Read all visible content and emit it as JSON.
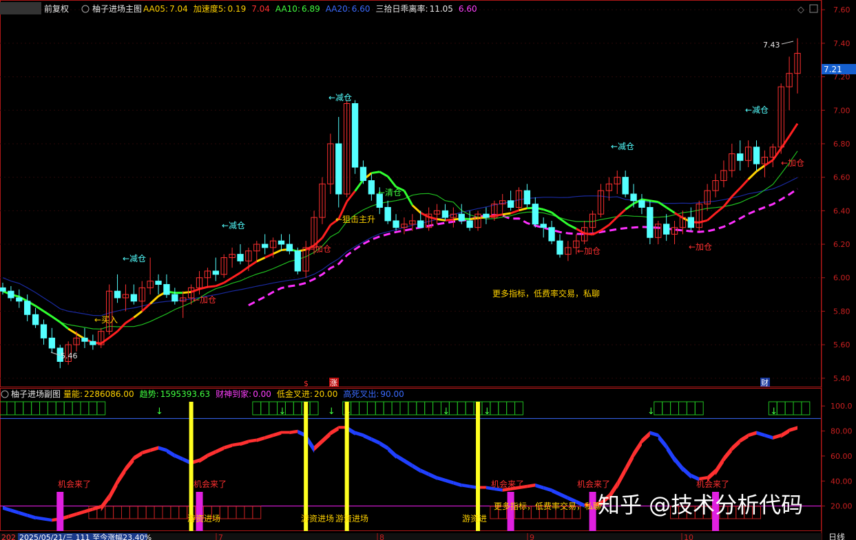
{
  "main_header": {
    "mode": "前复权",
    "title": "柚子进场主图",
    "items": [
      {
        "label": "AA05:",
        "value": "7.04",
        "label_color": "#ffd200",
        "value_color": "#ffd200"
      },
      {
        "label": "加速度5:",
        "value": "0.19",
        "label_color": "#ffd200",
        "value_color": "#ffd200"
      },
      {
        "label": "",
        "value": "7.04",
        "label_color": "#ff3030",
        "value_color": "#ff3030"
      },
      {
        "label": "AA10:",
        "value": "6.89",
        "label_color": "#40ff40",
        "value_color": "#40ff40"
      },
      {
        "label": "AA20:",
        "value": "6.60",
        "label_color": "#3a6bff",
        "value_color": "#3a6bff"
      },
      {
        "label": "三拾日乖离率:",
        "value": "11.05",
        "label_color": "#e8e8e8",
        "value_color": "#e8e8e8"
      },
      {
        "label": "",
        "value": "6.60",
        "label_color": "#ff40ff",
        "value_color": "#ff40ff"
      }
    ]
  },
  "sub_header": {
    "title": "柚子进场副图",
    "items": [
      {
        "label": "量能:",
        "value": "2286086.00",
        "color": "#ffd200"
      },
      {
        "label": "趋势:",
        "value": "1595393.63",
        "color": "#40ff40"
      },
      {
        "label": "财神到家:",
        "value": "0.00",
        "color": "#ff40ff"
      },
      {
        "label": "低金叉进:",
        "value": "20.00",
        "color": "#ffd200"
      },
      {
        "label": "高死叉出:",
        "value": "90.00",
        "color": "#3a6bff"
      }
    ]
  },
  "price_axis": {
    "ticks": [
      "7.60",
      "7.40",
      "7.20",
      "7.00",
      "6.80",
      "6.60",
      "6.40",
      "6.20",
      "6.00",
      "5.80",
      "5.60",
      "5.40"
    ],
    "current": "7.21"
  },
  "osc_axis": {
    "ticks": [
      "100.0",
      "80.00",
      "60.00",
      "40.00",
      "20.00"
    ]
  },
  "annotations": {
    "high": "7.43",
    "low": "5.46",
    "buy": "←买入",
    "add": "←加仓",
    "reduce": "←减仓",
    "clear": "←清仓",
    "snipe": "←狙击主升",
    "more": "更多指标，低费率交易，私聊",
    "opportunity": "机会来了",
    "hot_money": "游资进场",
    "hot_money_short": "游资进",
    "more_short": "更多指标，低费率交易，私聊",
    "sig_dollar": "$",
    "sig_zhang": "涨",
    "sig_cai": "财"
  },
  "bottom_bar": {
    "left_year": "202",
    "date_text": "2025/05/21/三  111 至今涨幅23.40%",
    "month_labels": [
      "7",
      "8",
      "9",
      "10"
    ],
    "right_label": "日线"
  },
  "watermark": "知乎 @技术分析代码",
  "colors": {
    "up": "#ff3030",
    "down": "#54ffff",
    "frame": "#b01818",
    "yellow": "#ffff20",
    "magenta": "#ff20ff"
  },
  "chart_data": {
    "type": "candlestick",
    "ylim": [
      5.35,
      7.65
    ],
    "candles": [
      [
        5.94,
        5.97,
        5.9,
        5.92
      ],
      [
        5.92,
        5.95,
        5.86,
        5.88
      ],
      [
        5.88,
        5.93,
        5.82,
        5.86
      ],
      [
        5.86,
        5.9,
        5.74,
        5.78
      ],
      [
        5.78,
        5.82,
        5.7,
        5.72
      ],
      [
        5.72,
        5.75,
        5.6,
        5.64
      ],
      [
        5.64,
        5.7,
        5.55,
        5.58
      ],
      [
        5.58,
        5.6,
        5.46,
        5.5
      ],
      [
        5.5,
        5.62,
        5.48,
        5.6
      ],
      [
        5.6,
        5.68,
        5.56,
        5.64
      ],
      [
        5.64,
        5.7,
        5.58,
        5.62
      ],
      [
        5.62,
        5.66,
        5.57,
        5.6
      ],
      [
        5.6,
        5.7,
        5.58,
        5.68
      ],
      [
        5.68,
        5.96,
        5.66,
        5.92
      ],
      [
        5.92,
        6.02,
        5.85,
        5.88
      ],
      [
        5.88,
        5.96,
        5.8,
        5.9
      ],
      [
        5.9,
        5.96,
        5.84,
        5.86
      ],
      [
        5.86,
        5.98,
        5.8,
        5.94
      ],
      [
        5.94,
        6.12,
        5.9,
        5.98
      ],
      [
        5.98,
        6.02,
        5.9,
        5.96
      ],
      [
        5.96,
        6.02,
        5.88,
        5.9
      ],
      [
        5.9,
        5.94,
        5.84,
        5.86
      ],
      [
        5.86,
        5.92,
        5.76,
        5.88
      ],
      [
        5.88,
        5.96,
        5.84,
        5.94
      ],
      [
        5.94,
        6.04,
        5.9,
        6.0
      ],
      [
        6.0,
        6.06,
        5.94,
        6.04
      ],
      [
        6.04,
        6.12,
        5.98,
        6.02
      ],
      [
        6.02,
        6.14,
        6.0,
        6.12
      ],
      [
        6.12,
        6.18,
        6.06,
        6.14
      ],
      [
        6.14,
        6.2,
        6.08,
        6.1
      ],
      [
        6.1,
        6.18,
        6.04,
        6.16
      ],
      [
        6.16,
        6.22,
        6.1,
        6.2
      ],
      [
        6.2,
        6.26,
        6.14,
        6.18
      ],
      [
        6.18,
        6.24,
        6.12,
        6.22
      ],
      [
        6.22,
        6.26,
        6.16,
        6.2
      ],
      [
        6.2,
        6.26,
        6.14,
        6.16
      ],
      [
        6.16,
        6.18,
        6.02,
        6.04
      ],
      [
        6.04,
        6.22,
        6.0,
        6.18
      ],
      [
        6.18,
        6.4,
        6.14,
        6.36
      ],
      [
        6.36,
        6.6,
        6.32,
        6.56
      ],
      [
        6.56,
        6.86,
        6.5,
        6.8
      ],
      [
        6.8,
        6.96,
        6.42,
        6.5
      ],
      [
        6.5,
        7.06,
        6.48,
        7.04
      ],
      [
        7.04,
        7.06,
        6.62,
        6.66
      ],
      [
        6.66,
        6.7,
        6.56,
        6.58
      ],
      [
        6.58,
        6.62,
        6.46,
        6.5
      ],
      [
        6.5,
        6.54,
        6.38,
        6.42
      ],
      [
        6.42,
        6.46,
        6.32,
        6.34
      ],
      [
        6.34,
        6.38,
        6.28,
        6.3
      ],
      [
        6.3,
        6.36,
        6.26,
        6.32
      ],
      [
        6.32,
        6.38,
        6.28,
        6.34
      ],
      [
        6.34,
        6.4,
        6.3,
        6.3
      ],
      [
        6.3,
        6.42,
        6.28,
        6.38
      ],
      [
        6.38,
        6.44,
        6.32,
        6.4
      ],
      [
        6.4,
        6.44,
        6.34,
        6.36
      ],
      [
        6.36,
        6.42,
        6.3,
        6.38
      ],
      [
        6.38,
        6.44,
        6.32,
        6.34
      ],
      [
        6.34,
        6.4,
        6.28,
        6.3
      ],
      [
        6.3,
        6.4,
        6.28,
        6.38
      ],
      [
        6.38,
        6.42,
        6.32,
        6.36
      ],
      [
        6.36,
        6.46,
        6.34,
        6.44
      ],
      [
        6.44,
        6.5,
        6.38,
        6.46
      ],
      [
        6.46,
        6.52,
        6.4,
        6.42
      ],
      [
        6.42,
        6.54,
        6.4,
        6.52
      ],
      [
        6.52,
        6.56,
        6.42,
        6.44
      ],
      [
        6.44,
        6.48,
        6.3,
        6.32
      ],
      [
        6.32,
        6.36,
        6.24,
        6.3
      ],
      [
        6.3,
        6.34,
        6.2,
        6.22
      ],
      [
        6.22,
        6.26,
        6.12,
        6.14
      ],
      [
        6.14,
        6.22,
        6.1,
        6.18
      ],
      [
        6.18,
        6.26,
        6.14,
        6.22
      ],
      [
        6.22,
        6.34,
        6.2,
        6.3
      ],
      [
        6.3,
        6.4,
        6.26,
        6.38
      ],
      [
        6.38,
        6.56,
        6.36,
        6.52
      ],
      [
        6.52,
        6.6,
        6.46,
        6.56
      ],
      [
        6.56,
        6.64,
        6.5,
        6.6
      ],
      [
        6.6,
        6.64,
        6.48,
        6.5
      ],
      [
        6.5,
        6.56,
        6.42,
        6.46
      ],
      [
        6.46,
        6.5,
        6.38,
        6.42
      ],
      [
        6.42,
        6.46,
        6.2,
        6.24
      ],
      [
        6.24,
        6.34,
        6.2,
        6.32
      ],
      [
        6.32,
        6.38,
        6.22,
        6.26
      ],
      [
        6.26,
        6.34,
        6.2,
        6.3
      ],
      [
        6.3,
        6.4,
        6.26,
        6.36
      ],
      [
        6.36,
        6.42,
        6.28,
        6.3
      ],
      [
        6.3,
        6.46,
        6.28,
        6.44
      ],
      [
        6.44,
        6.56,
        6.4,
        6.52
      ],
      [
        6.52,
        6.62,
        6.48,
        6.58
      ],
      [
        6.58,
        6.7,
        6.54,
        6.64
      ],
      [
        6.64,
        6.8,
        6.6,
        6.74
      ],
      [
        6.74,
        6.82,
        6.64,
        6.7
      ],
      [
        6.7,
        6.82,
        6.66,
        6.78
      ],
      [
        6.78,
        6.82,
        6.64,
        6.68
      ],
      [
        6.68,
        6.76,
        6.6,
        6.72
      ],
      [
        6.72,
        6.8,
        6.66,
        6.78
      ],
      [
        6.78,
        7.16,
        6.74,
        7.14
      ],
      [
        7.14,
        7.32,
        7.0,
        7.22
      ],
      [
        7.22,
        7.43,
        7.1,
        7.34
      ]
    ],
    "osc": [
      20,
      18,
      16,
      14,
      12,
      11,
      10,
      11,
      13,
      15,
      17,
      19,
      21,
      30,
      42,
      52,
      60,
      64,
      66,
      68,
      66,
      62,
      59,
      56,
      58,
      62,
      65,
      68,
      70,
      71,
      73,
      74,
      76,
      78,
      80,
      80,
      81,
      78,
      68,
      74,
      80,
      84,
      84,
      80,
      78,
      75,
      72,
      68,
      62,
      58,
      54,
      50,
      47,
      44,
      42,
      40,
      38,
      37,
      36,
      36,
      35,
      34,
      35,
      36,
      37,
      38,
      36,
      34,
      31,
      28,
      25,
      22,
      22,
      24,
      30,
      40,
      52,
      64,
      74,
      80,
      78,
      70,
      60,
      52,
      46,
      43,
      44,
      50,
      60,
      68,
      74,
      78,
      80,
      78,
      76,
      78,
      82,
      84
    ]
  }
}
